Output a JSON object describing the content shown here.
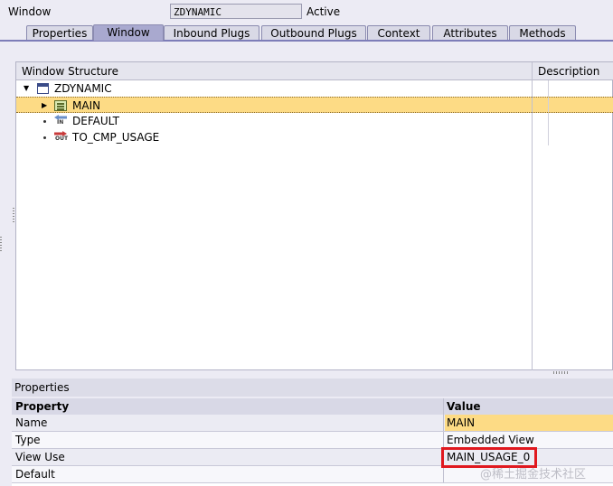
{
  "header": {
    "window_label": "Window",
    "window_name": "ZDYNAMIC",
    "status": "Active"
  },
  "tabs": [
    {
      "label": "Properties",
      "active": false
    },
    {
      "label": "Window",
      "active": true
    },
    {
      "label": "Inbound Plugs",
      "active": false
    },
    {
      "label": "Outbound Plugs",
      "active": false
    },
    {
      "label": "Context",
      "active": false
    },
    {
      "label": "Attributes",
      "active": false
    },
    {
      "label": "Methods",
      "active": false
    }
  ],
  "structure": {
    "col_structure": "Window Structure",
    "col_description": "Description",
    "rows": [
      {
        "label": "ZDYNAMIC",
        "icon": "window-icon",
        "expanded": true
      },
      {
        "label": "MAIN",
        "icon": "view-icon",
        "selected": true
      },
      {
        "label": "DEFAULT",
        "icon": "inbound-plug-icon"
      },
      {
        "label": "TO_CMP_USAGE",
        "icon": "outbound-plug-icon"
      }
    ],
    "icon_text_in": "IN",
    "icon_text_out": "OUT"
  },
  "properties": {
    "title": "Properties",
    "col_property": "Property",
    "col_value": "Value",
    "rows": [
      {
        "name": "Name",
        "value": "MAIN"
      },
      {
        "name": "Type",
        "value": "Embedded View"
      },
      {
        "name": "View Use",
        "value": "MAIN_USAGE_0"
      },
      {
        "name": "Default",
        "value": ""
      }
    ]
  },
  "colors": {
    "selection": "#fddb85",
    "active_tab": "#a9a9cf",
    "highlight_box": "#e0181f"
  },
  "watermark": "@稀土掘金技术社区"
}
